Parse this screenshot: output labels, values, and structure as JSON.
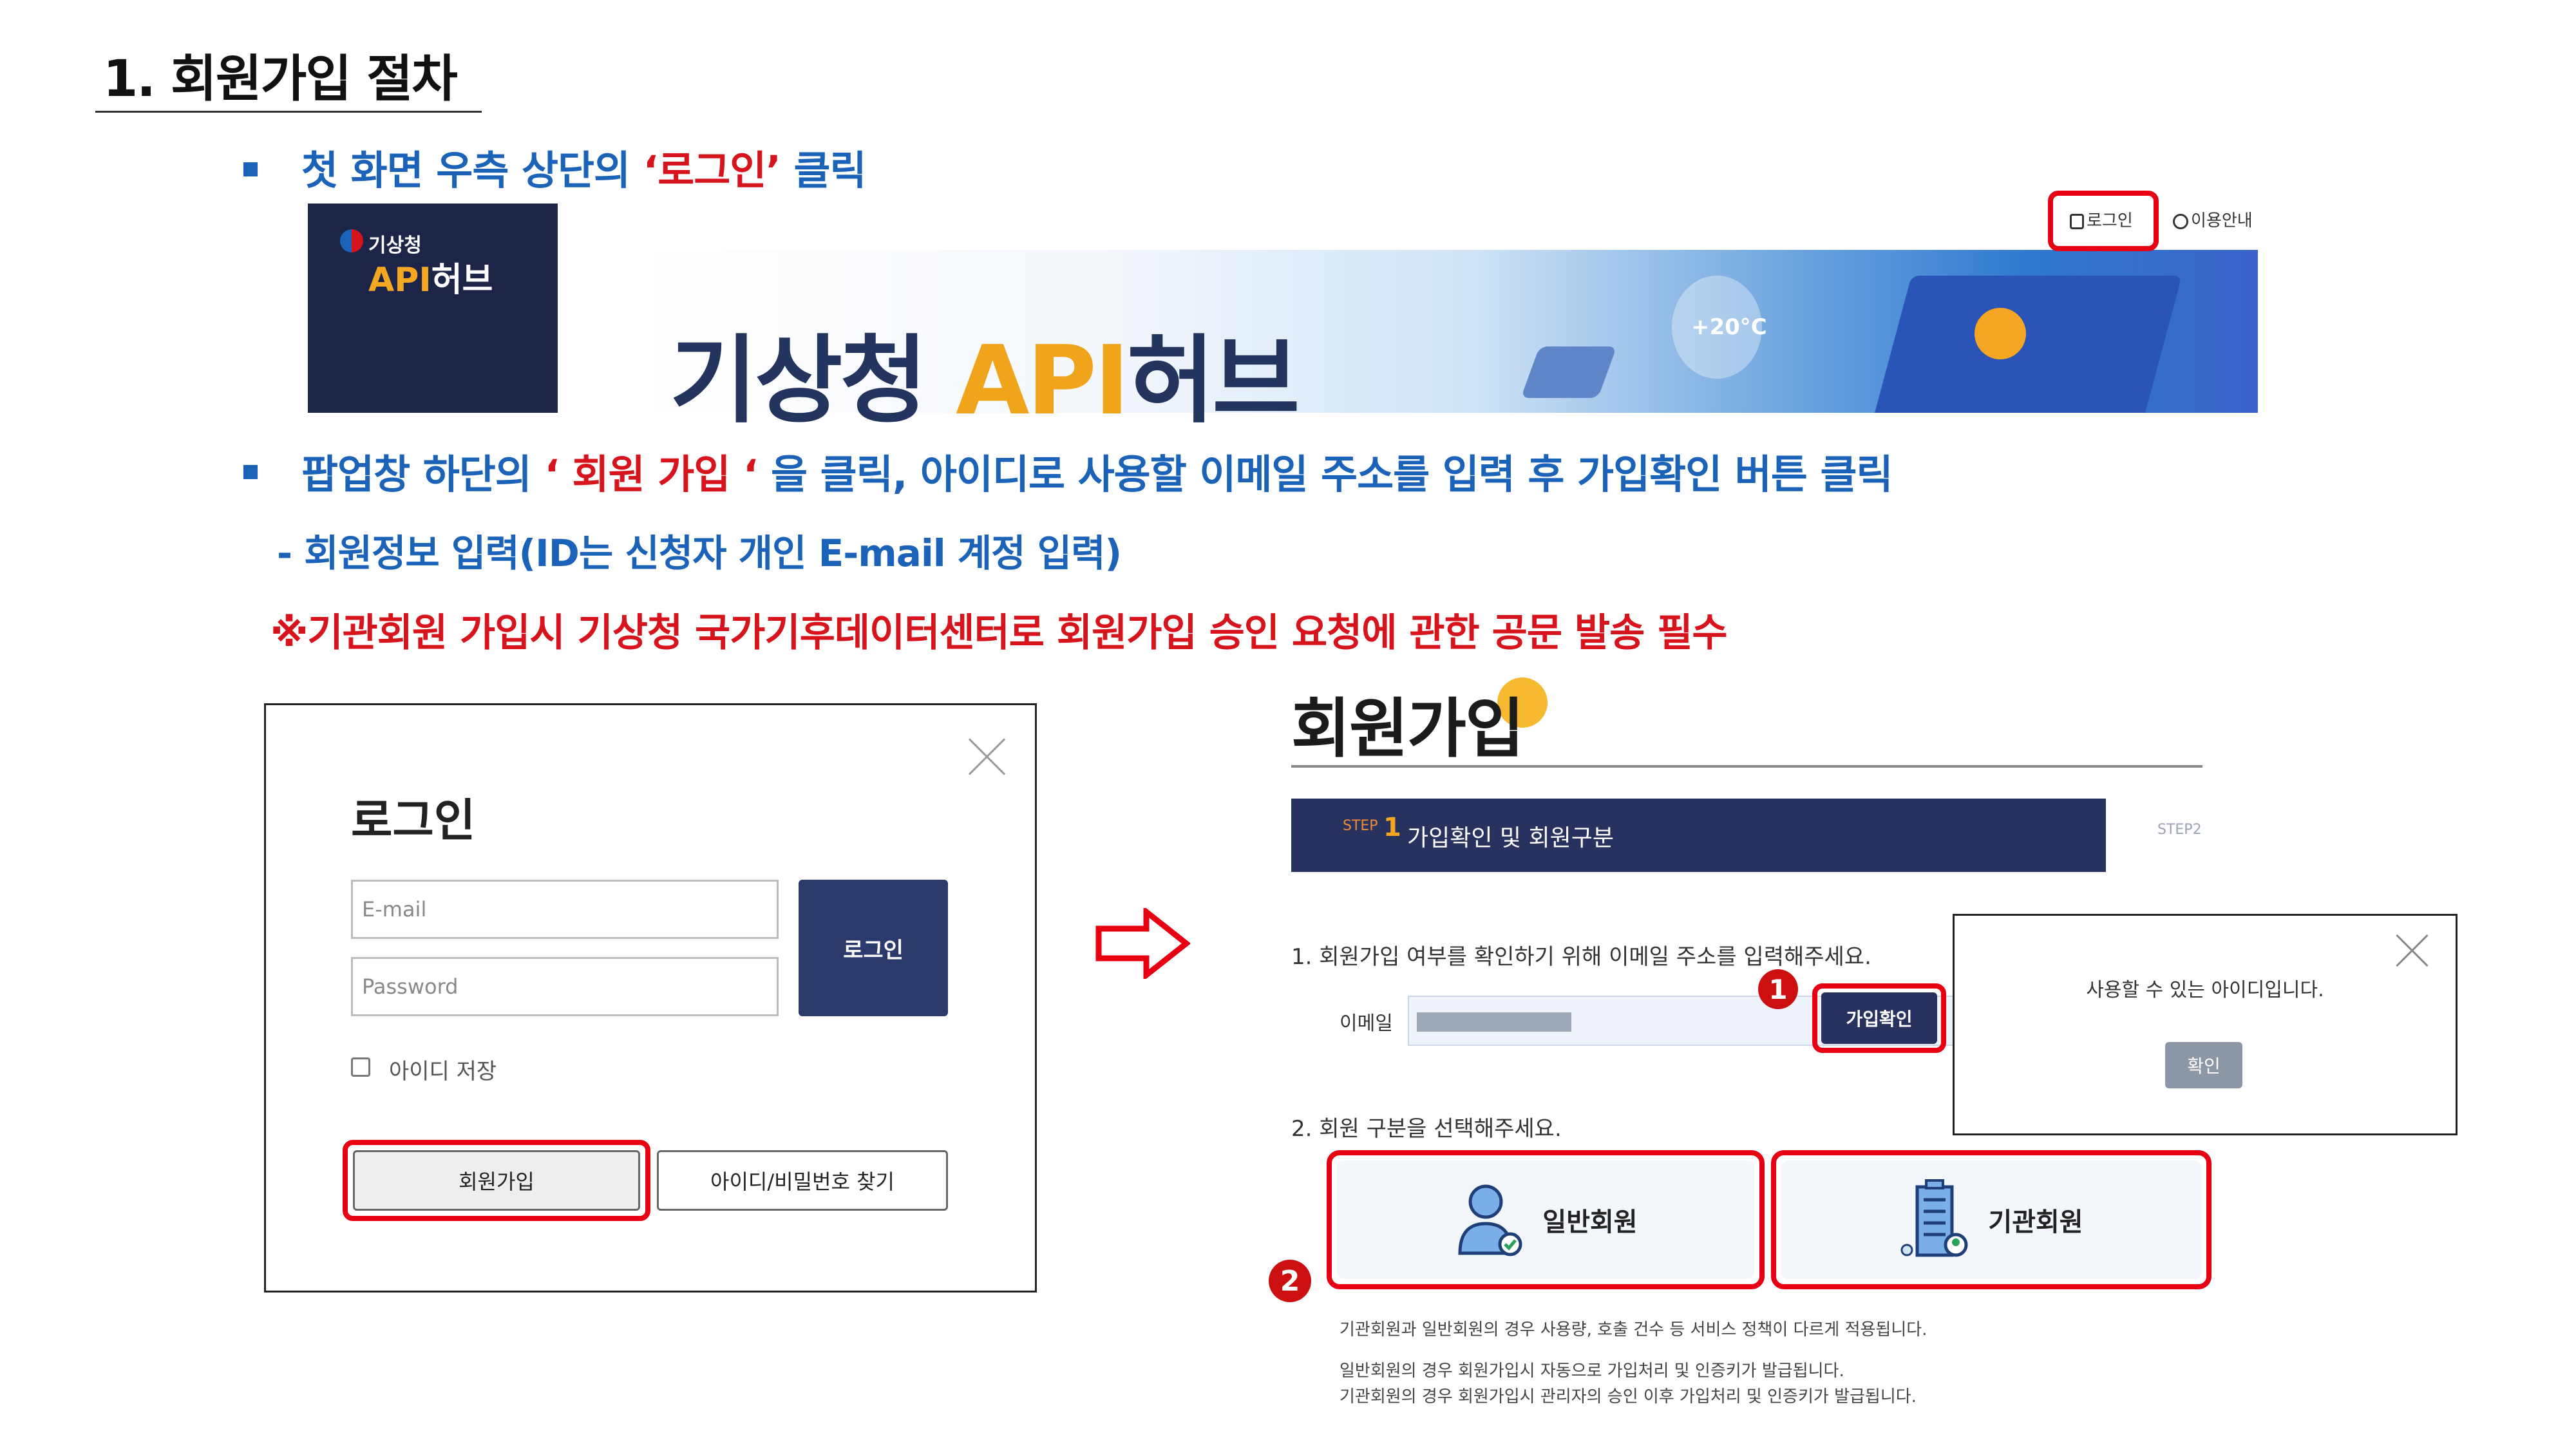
{
  "section": {
    "title": "1. 회원가입 절차"
  },
  "step1": {
    "text_before": "첫 화면 우측 상단의 ",
    "highlight": "‘로그인’",
    "text_after": "  클릭"
  },
  "header_screenshot": {
    "logo_small": "기상청",
    "logo_big_api": "API",
    "logo_big_rest": "허브",
    "banner_title_part1": "기상청 ",
    "banner_title_api": "API",
    "banner_title_part2": "허브",
    "banner_deco_text": "+20°C",
    "login_link": "로그인",
    "guide_link": "이용안내"
  },
  "step2": {
    "text_before": "팝업창 하단의 ",
    "highlight": "‘ 회원 가입 ‘",
    "text_after": " 을 클릭, 아이디로 사용할 이메일 주소를 입력 후 가입확인 버튼 클릭"
  },
  "step2_sub": "-  회원정보 입력(ID는 신청자 개인 E-mail  계정 입력)",
  "warning": "※기관회원 가입시 기상청 국가기후데이터센터로 회원가입 승인 요청에 관한 공문 발송 필수",
  "login_popup": {
    "heading": "로그인",
    "email_placeholder": "E-mail",
    "password_placeholder": "Password",
    "login_button": "로그인",
    "remember_label": "아이디 저장",
    "signup_button": "회원가입",
    "find_button": "아이디/비밀번호 찾기"
  },
  "signup_page": {
    "heading": "회원가입",
    "step_prefix": "STEP",
    "step_number": "1",
    "step_label": "가입확인 및 회원구분",
    "step2_prefix": "STEP2",
    "question1": "1. 회원가입 여부를 확인하기 위해 이메일 주소를 입력해주세요.",
    "email_label": "이메일",
    "confirm_button": "가입확인",
    "question2": "2. 회원 구분을 선택해주세요.",
    "general_member": "일반회원",
    "org_member": "기관회원",
    "note1": "기관회원과 일반회원의 경우 사용량, 호출 건수 등 서비스 정책이 다르게 적용됩니다.",
    "note2": "일반회원의 경우 회원가입시 자동으로 가입처리 및 인증키가 발급됩니다.",
    "note3": "기관회원의 경우 회원가입시 관리자의 승인 이후 가입처리 및 인증키가 발급됩니다."
  },
  "alert_popup": {
    "message": "사용할 수 있는 아이디입니다.",
    "ok_button": "확인"
  },
  "badges": {
    "first": "1",
    "second": "2"
  },
  "colors": {
    "instruction_blue": "#1a63b8",
    "highlight_red": "#d7141c",
    "navy": "#27325f",
    "api_orange": "#f0a41c"
  }
}
